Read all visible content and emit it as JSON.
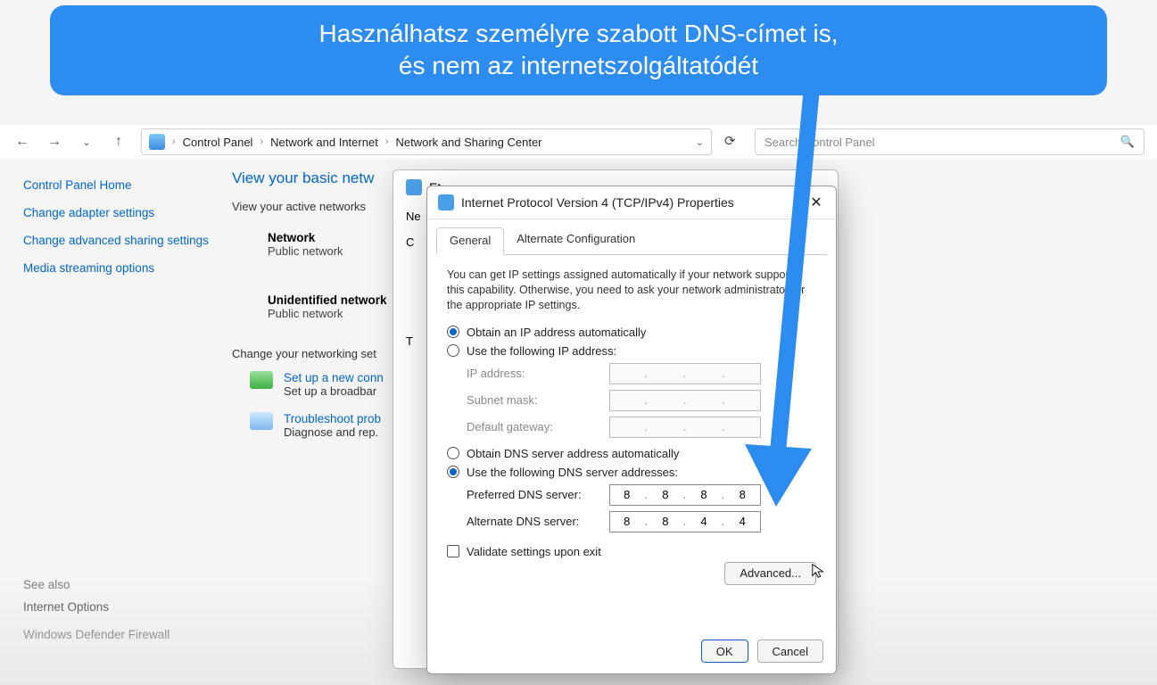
{
  "callout": {
    "line1": "Használhatsz személyre szabott DNS-címet is,",
    "line2": "és nem az internetszolgáltatódét"
  },
  "breadcrumb": {
    "items": [
      "Control Panel",
      "Network and Internet",
      "Network and Sharing Center"
    ]
  },
  "search": {
    "placeholder": "Search Control Panel"
  },
  "sidebar": {
    "home": "Control Panel Home",
    "links": [
      "Change adapter settings",
      "Change advanced sharing settings",
      "Media streaming options"
    ],
    "see_also_label": "See also",
    "see_also": [
      "Internet Options",
      "Windows Defender Firewall"
    ]
  },
  "main": {
    "heading": "View your basic netw",
    "active_label": "View your active networks",
    "network1": {
      "name": "Network",
      "type": "Public network"
    },
    "network2": {
      "name": "Unidentified network",
      "type": "Public network"
    },
    "change_label": "Change your networking set",
    "task1": {
      "link": "Set up a new conn",
      "desc": "Set up a broadbar"
    },
    "task2": {
      "link": "Troubleshoot prob",
      "desc": "Diagnose and rep."
    }
  },
  "back_dialog": {
    "title": "Et",
    "tab": "Ne",
    "label_c": "C",
    "label_t": "T"
  },
  "dialog": {
    "title": "Internet Protocol Version 4 (TCP/IPv4) Properties",
    "tabs": {
      "general": "General",
      "alternate": "Alternate Configuration"
    },
    "description": "You can get IP settings assigned automatically if your network supports this capability. Otherwise, you need to ask your network administrator for the appropriate IP settings.",
    "ip_auto": "Obtain an IP address automatically",
    "ip_manual": "Use the following IP address:",
    "fields_ip": {
      "address": "IP address:",
      "subnet": "Subnet mask:",
      "gateway": "Default gateway:"
    },
    "dns_auto": "Obtain DNS server address automatically",
    "dns_manual": "Use the following DNS server addresses:",
    "fields_dns": {
      "preferred": "Preferred DNS server:",
      "alternate": "Alternate DNS server:",
      "preferred_value": [
        "8",
        "8",
        "8",
        "8"
      ],
      "alternate_value": [
        "8",
        "8",
        "4",
        "4"
      ]
    },
    "validate": "Validate settings upon exit",
    "advanced": "Advanced...",
    "ok": "OK",
    "cancel": "Cancel"
  }
}
